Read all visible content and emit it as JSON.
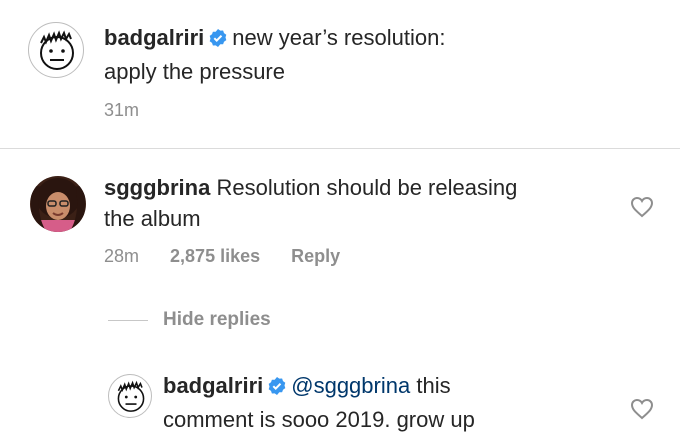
{
  "caption": {
    "username": "badgalriri",
    "text_line1": "new year’s resolution:",
    "text_line2": "apply the pressure",
    "time": "31m"
  },
  "comment": {
    "username": "sgggbrina",
    "text_line1": "Resolution should be releasing",
    "text_line2": "the album",
    "time": "28m",
    "likes": "2,875 likes",
    "reply_label": "Reply",
    "hide_replies_label": "Hide replies"
  },
  "reply": {
    "username": "badgalriri",
    "mention": "@sgggbrina",
    "text_line1_rest": "this",
    "text_line2": "comment is sooo 2019. grow up"
  },
  "colors": {
    "verified": "#3897f0",
    "meta_gray": "#8e8e8e",
    "divider": "#dbdbdb",
    "mention": "#00376b"
  },
  "icons": [
    "verified-badge-icon",
    "heart-icon",
    "avatar-doodle-face"
  ]
}
